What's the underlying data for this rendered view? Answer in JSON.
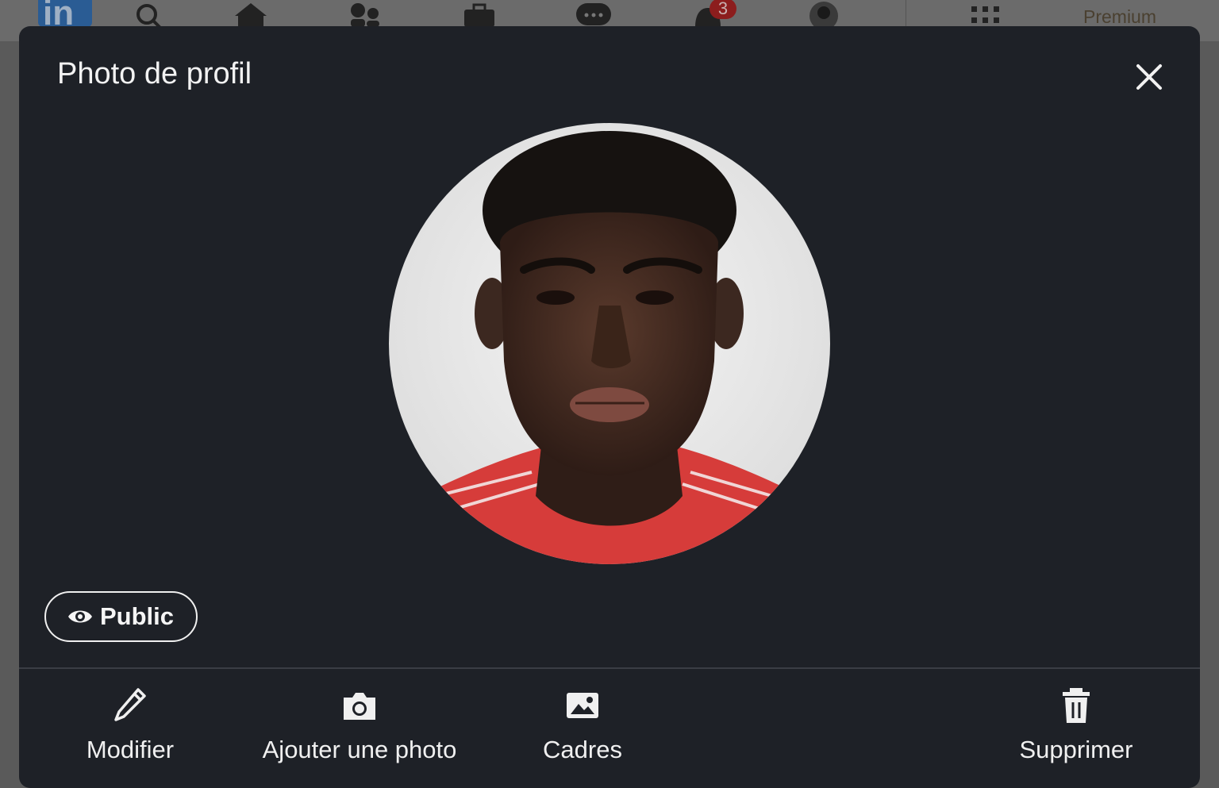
{
  "nav": {
    "logo_text": "in",
    "notifications_count": "3",
    "premium_label": "Premium",
    "icons": [
      "search-icon",
      "home-icon",
      "network-icon",
      "jobs-icon",
      "messaging-icon",
      "bell-icon",
      "avatar",
      "grid-icon"
    ]
  },
  "modal": {
    "title": "Photo de profil",
    "visibility_label": "Public",
    "actions": [
      {
        "label": "Modifier",
        "icon": "pencil-icon"
      },
      {
        "label": "Ajouter une photo",
        "icon": "camera-icon"
      },
      {
        "label": "Cadres",
        "icon": "image-icon"
      },
      {
        "label": "Supprimer",
        "icon": "trash-icon"
      }
    ]
  },
  "colors": {
    "modal_bg": "#1e2127",
    "text": "#f2f2f2",
    "overlay": "#5a5a5a"
  }
}
